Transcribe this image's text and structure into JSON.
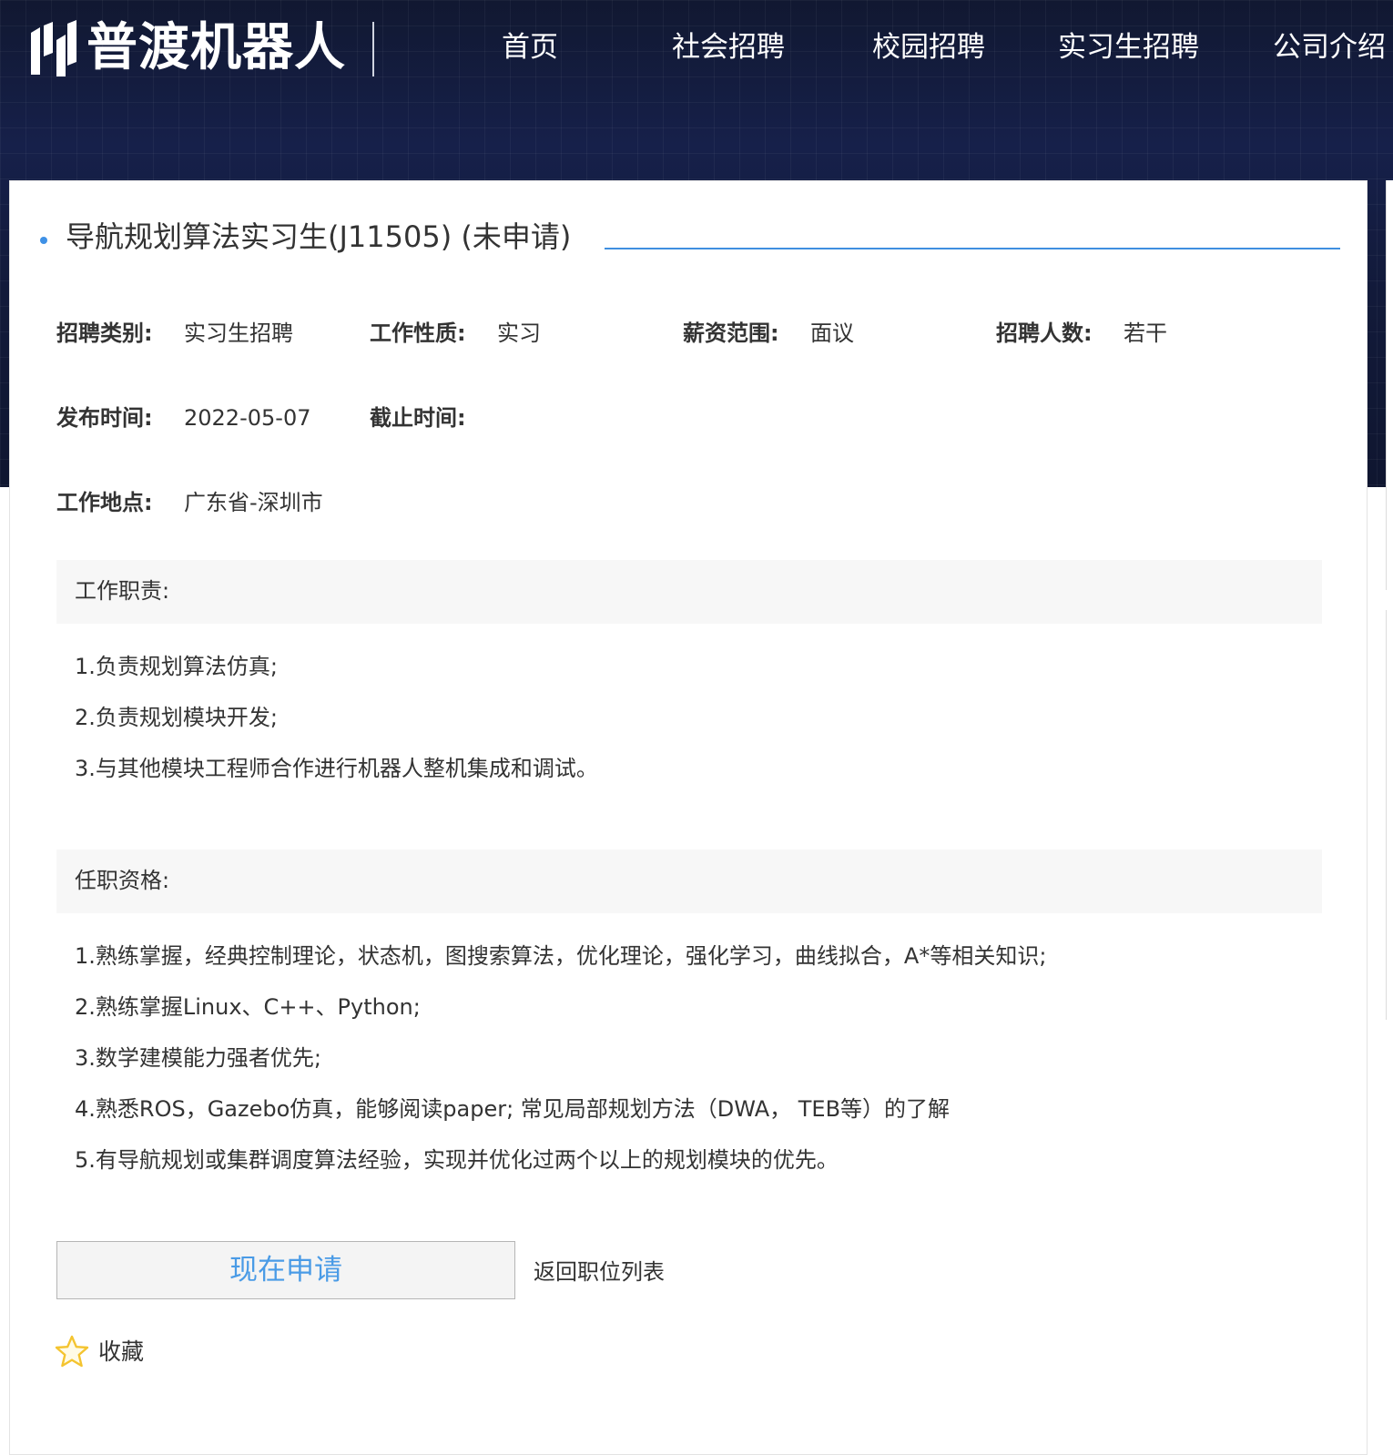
{
  "header": {
    "brand": "普渡机器人",
    "nav": [
      {
        "label": "首页"
      },
      {
        "label": "社会招聘"
      },
      {
        "label": "校园招聘"
      },
      {
        "label": "实习生招聘"
      },
      {
        "label": "公司介绍"
      }
    ]
  },
  "job": {
    "title": "导航规划算法实习生(J11505) (未申请)",
    "meta": {
      "category_label": "招聘类别:",
      "category_value": "实习生招聘",
      "nature_label": "工作性质:",
      "nature_value": "实习",
      "salary_label": "薪资范围:",
      "salary_value": "面议",
      "headcount_label": "招聘人数:",
      "headcount_value": "若干",
      "publish_label": "发布时间:",
      "publish_value": "2022-05-07",
      "deadline_label": "截止时间:",
      "deadline_value": "",
      "location_label": "工作地点:",
      "location_value": "广东省-深圳市"
    },
    "duties": {
      "heading": "工作职责:",
      "items": [
        "1.负责规划算法仿真;",
        "2.负责规划模块开发;",
        "3.与其他模块工程师合作进行机器人整机集成和调试。"
      ]
    },
    "qualifications": {
      "heading": "任职资格:",
      "items": [
        "1.熟练掌握，经典控制理论，状态机，图搜索算法，优化理论，强化学习，曲线拟合，A*等相关知识;",
        "2.熟练掌握Linux、C++、Python;",
        "3.数学建模能力强者优先;",
        "4.熟悉ROS，Gazebo仿真，能够阅读paper; 常见局部规划方法（DWA， TEB等）的了解",
        "5.有导航规划或集群调度算法经验，实现并优化过两个以上的规划模块的优先。"
      ]
    }
  },
  "actions": {
    "apply_label": "现在申请",
    "back_label": "返回职位列表",
    "favorite_label": "收藏"
  },
  "colors": {
    "header_bg": "#141c37",
    "accent_blue": "#3f8fe0",
    "star_yellow": "#f4c430",
    "text": "#333333"
  },
  "icons": {
    "logo": "brand-logo-mark",
    "favorite": "star-outline-icon",
    "title_bullet": "dot-bullet"
  }
}
